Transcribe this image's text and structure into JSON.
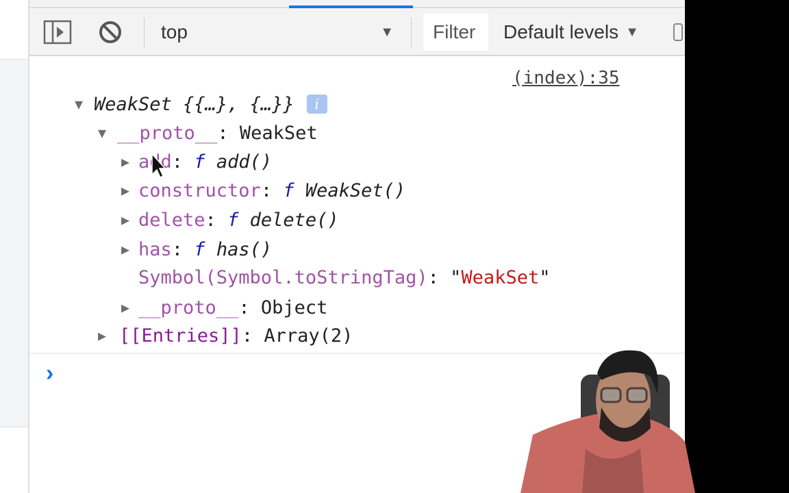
{
  "toolbar": {
    "sidebar_toggle_icon": "sidebar-toggle-icon",
    "clear_icon": "clear-console-icon",
    "context": "top",
    "filter_placeholder": "Filter",
    "levels": "Default levels"
  },
  "console": {
    "source_link": "(index):35",
    "root": {
      "label": "WeakSet {{…}, {…}}"
    },
    "proto": {
      "key": "__proto__",
      "value": "WeakSet"
    },
    "methods": [
      {
        "key": "add",
        "f": "f",
        "value": "add()"
      },
      {
        "key": "constructor",
        "f": "f",
        "value": "WeakSet()"
      },
      {
        "key": "delete",
        "f": "f",
        "value": "delete()"
      },
      {
        "key": "has",
        "f": "f",
        "value": "has()"
      }
    ],
    "tag": {
      "key": "Symbol(Symbol.toStringTag)",
      "value": "WeakSet"
    },
    "proto2": {
      "key": "__proto__",
      "value": "Object"
    },
    "entries": {
      "key": "[[Entries]]",
      "value": "Array(2)"
    },
    "prompt": "›"
  },
  "colors": {
    "accent": "#1a73e8",
    "key": "#a152a8",
    "string": "#c41a16",
    "function": "#1a1aa6"
  }
}
